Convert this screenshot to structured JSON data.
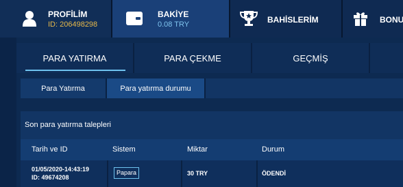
{
  "topnav": {
    "profile": {
      "title": "PROFİLİM",
      "sub": "ID: 206498298"
    },
    "balance": {
      "title": "BAKİYE",
      "sub": "0.08 TRY"
    },
    "bets": {
      "title": "BAHİSLERİM"
    },
    "bonus": {
      "title": "BONUS"
    }
  },
  "tabs": [
    {
      "label": "PARA YATIRMA",
      "active": true
    },
    {
      "label": "PARA ÇEKME"
    },
    {
      "label": "GEÇMİŞ"
    }
  ],
  "subtabs": [
    {
      "label": "Para Yatırma"
    },
    {
      "label": "Para yatırma durumu",
      "active": true
    }
  ],
  "section": {
    "title": "Son para yatırma talepleri",
    "columns": [
      "Tarih ve ID",
      "Sistem",
      "Miktar",
      "Durum"
    ],
    "rows": [
      {
        "date": "01/05/2020-14:43:19",
        "id": "ID: 49674208",
        "system": "Papara",
        "amount": "30 TRY",
        "status": "ÖDENDİ"
      }
    ]
  },
  "colors": {
    "accent": "#6fc3ef",
    "profile_id": "#e7b94a",
    "balance": "#7fc4ef"
  }
}
